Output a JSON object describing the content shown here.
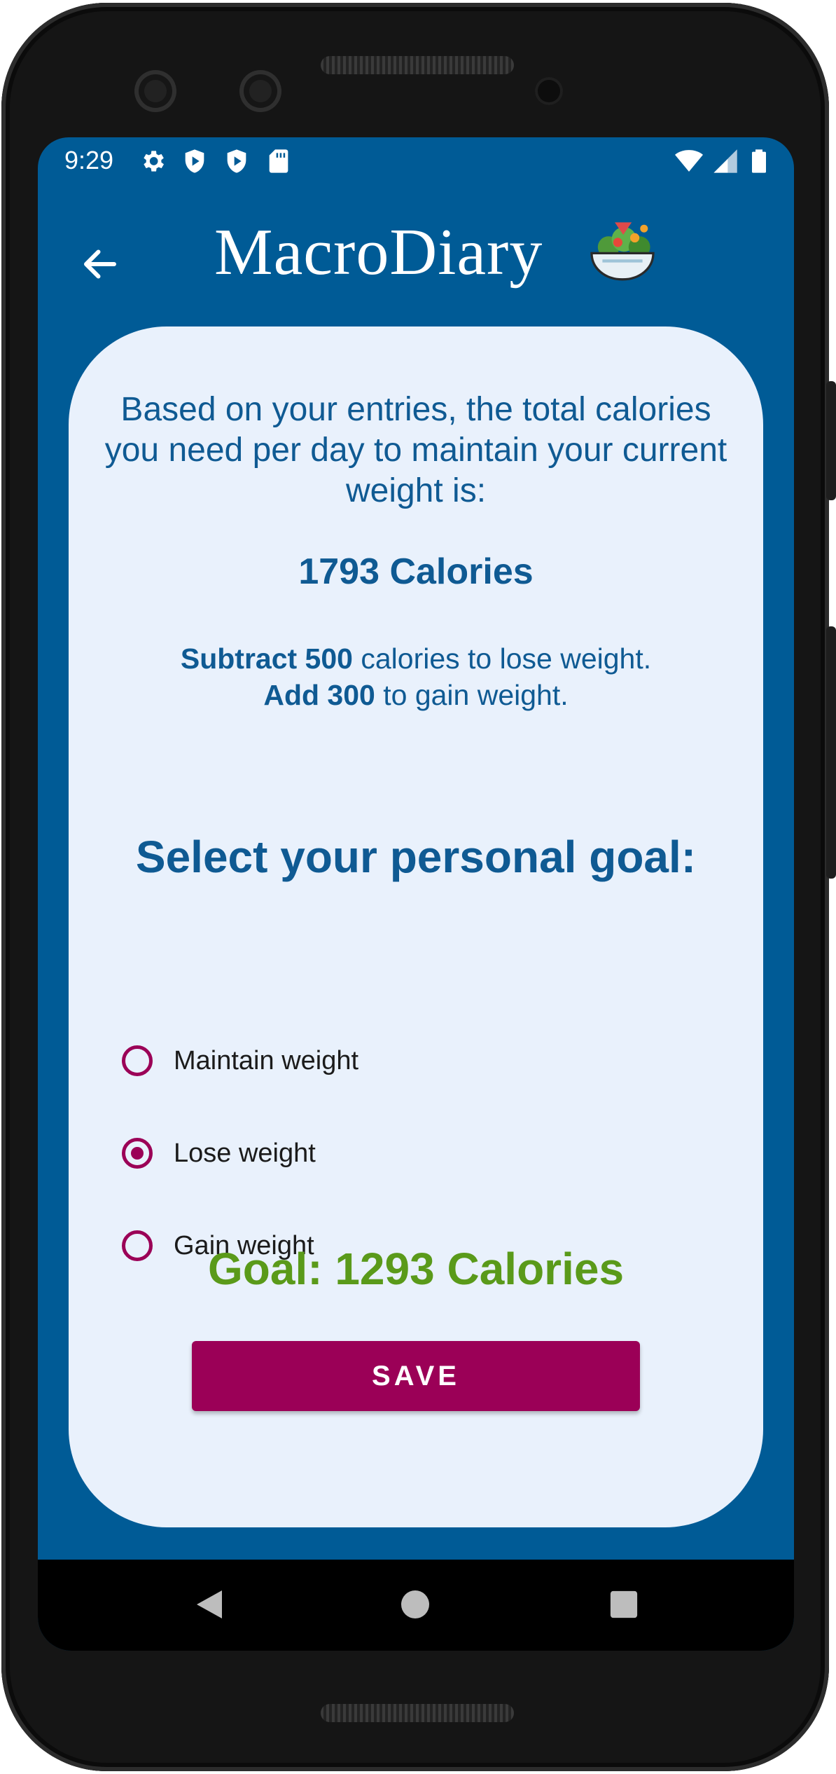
{
  "status": {
    "time": "9:29",
    "icons": [
      "settings-icon",
      "play-protect-icon",
      "play-protect-icon",
      "sd-card-icon",
      "wifi-icon",
      "signal-icon",
      "battery-icon"
    ]
  },
  "app": {
    "title": "MacroDiary",
    "logo_icon": "salad-bowl-icon"
  },
  "summary": {
    "intro": "Based on your entries, the total calories you need per day to maintain your current weight is:",
    "maintenance_calories": "1793 Calories",
    "lose_prefix": "Subtract 500",
    "lose_suffix": " calories to lose weight.",
    "gain_prefix": "Add 300",
    "gain_suffix": " to gain weight."
  },
  "goal": {
    "title": "Select your personal goal:",
    "options": [
      {
        "label": "Maintain weight",
        "selected": false
      },
      {
        "label": "Lose weight",
        "selected": true
      },
      {
        "label": "Gain weight",
        "selected": false
      }
    ],
    "result": "Goal: 1293 Calories",
    "save_label": "SAVE"
  },
  "colors": {
    "primary": "#005b96",
    "accent": "#9b0057",
    "goal_green": "#5a9a1a",
    "card_bg": "#e9f1fc"
  }
}
